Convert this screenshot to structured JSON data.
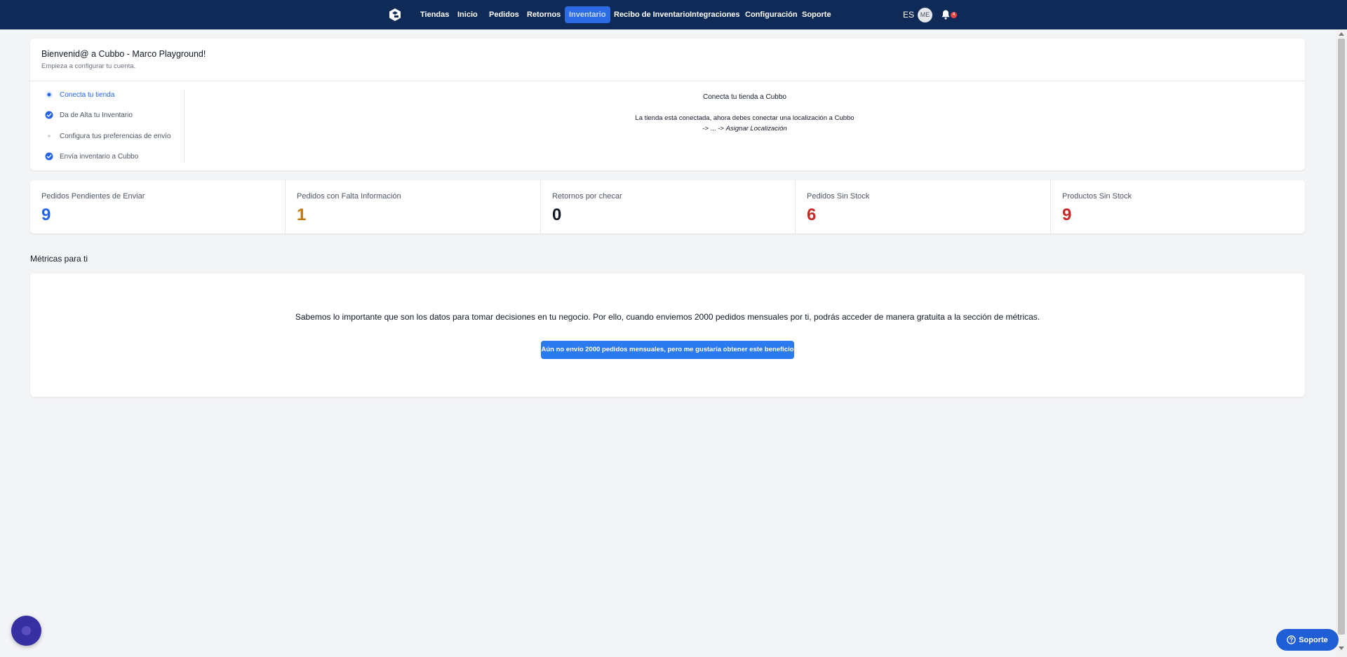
{
  "nav": {
    "links": [
      "Tiendas",
      "Inicio",
      "Pedidos",
      "Retornos",
      "Inventario",
      "Recibo de Inventario",
      "Integraciones",
      "Configuración",
      "Soporte"
    ],
    "active": "Inventario",
    "language": "ES",
    "avatar_initials": "ME",
    "notification_count": "4"
  },
  "welcome": {
    "title": "Bienvenid@ a Cubbo - Marco Playground!",
    "subtitle": "Empieza a configurar tu cuenta.",
    "steps": [
      {
        "label": "Conecta tu tienda",
        "status": "current"
      },
      {
        "label": "Da de Alta tu Inventario",
        "status": "complete"
      },
      {
        "label": "Configura tus preferencias de envío",
        "status": "pending"
      },
      {
        "label": "Envía inventario a Cubbo",
        "status": "complete"
      }
    ],
    "panel": {
      "title": "Conecta tu tienda a Cubbo",
      "text": "La tienda está conectada, ahora debes conectar una localización a Cubbo",
      "path_prefix": "-> ... ->",
      "path_link": "Asignar Localización"
    }
  },
  "stats": [
    {
      "label": "Pedidos Pendientes de Enviar",
      "value": "9",
      "color": "#2563eb"
    },
    {
      "label": "Pedidos con Falta Información",
      "value": "1",
      "color": "#c2770a"
    },
    {
      "label": "Retornos por checar",
      "value": "0",
      "color": "#111827"
    },
    {
      "label": "Pedidos Sin Stock",
      "value": "6",
      "color": "#c62828"
    },
    {
      "label": "Productos Sin Stock",
      "value": "9",
      "color": "#c62828"
    }
  ],
  "metrics": {
    "heading": "Métricas para ti",
    "text": "Sabemos lo importante que son los datos para tomar decisiones en tu negocio. Por ello, cuando enviemos 2000 pedidos mensuales por ti, podrás acceder de manera gratuita a la sección de métricas.",
    "button_label": "Aún no envío 2000 pedidos mensuales, pero me gustaría obtener este beneficio"
  },
  "support": {
    "label": "Soporte"
  },
  "colors": {
    "navbar": "#0f2a56",
    "accent": "#2b7af0",
    "active_tab": "#2b6be4"
  }
}
